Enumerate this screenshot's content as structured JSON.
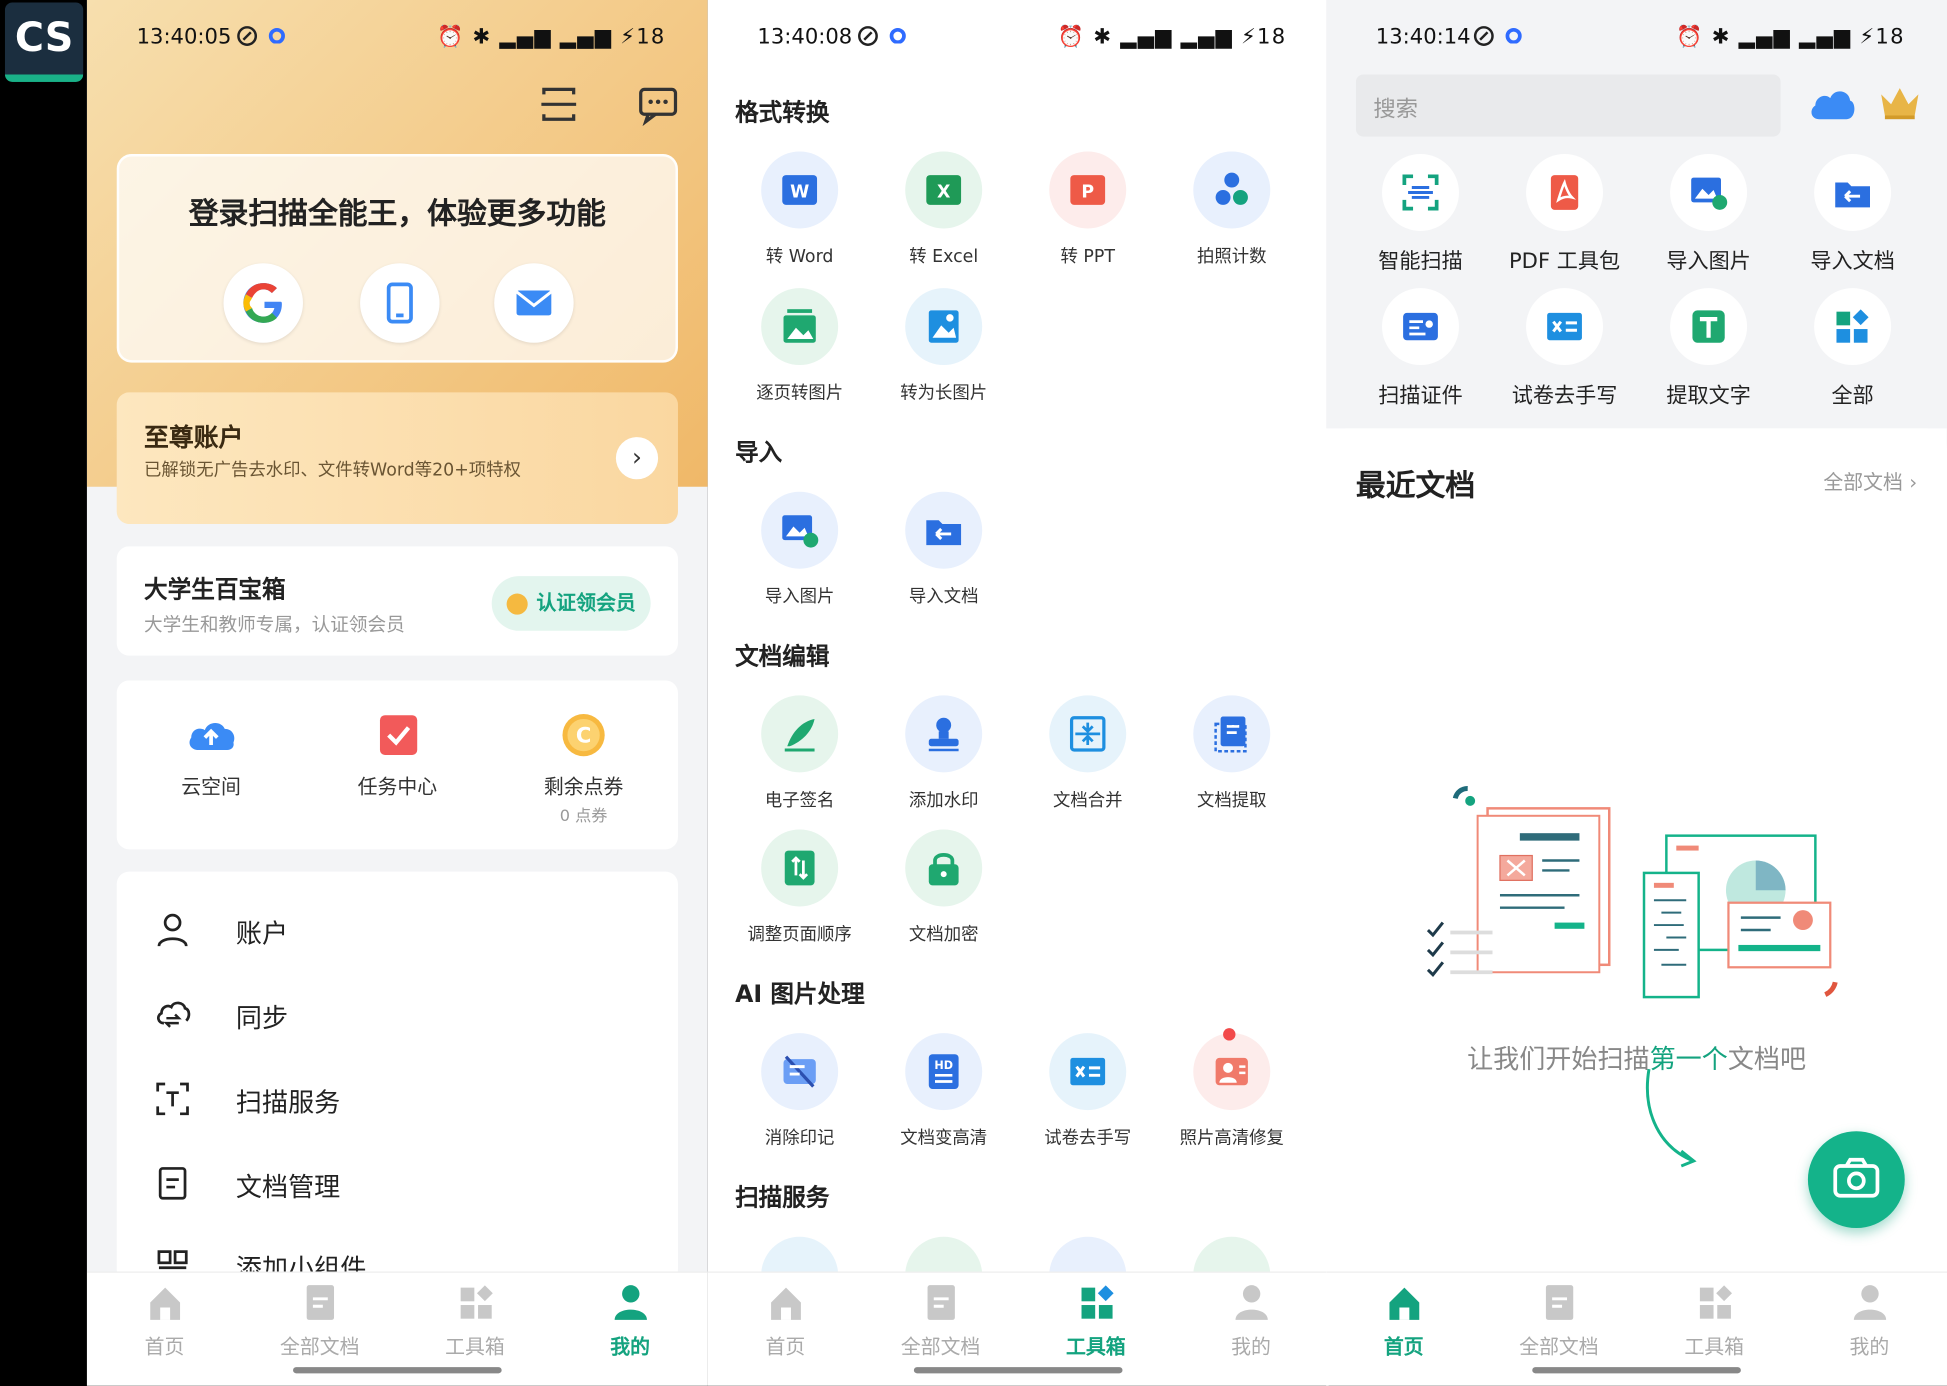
{
  "app_logo": "CS",
  "colors": {
    "brand": "#14a37f",
    "gold": "#f0b868",
    "red": "#f24a4a"
  },
  "status_bars": [
    {
      "time": "13:40:05",
      "right": "18"
    },
    {
      "time": "13:40:08",
      "right": "18"
    },
    {
      "time": "13:40:14",
      "right": "18"
    }
  ],
  "profile": {
    "login_title": "登录扫描全能王，体验更多功能",
    "login_methods": [
      "google-icon",
      "phone-icon",
      "email-icon"
    ],
    "vip": {
      "title": "至尊账户",
      "subtitle": "已解锁无广告去水印、文件转Word等20+项特权"
    },
    "student": {
      "title": "大学生百宝箱",
      "subtitle": "大学生和教师专属，认证领会员",
      "button": "认证领会员"
    },
    "quick": [
      {
        "label": "云空间",
        "sub": ""
      },
      {
        "label": "任务中心",
        "sub": ""
      },
      {
        "label": "剩余点券",
        "sub": "0 点券"
      }
    ],
    "menu": [
      "账户",
      "同步",
      "扫描服务",
      "文档管理",
      "添加小组件"
    ]
  },
  "tools": {
    "sections": [
      {
        "title": "格式转换",
        "items": [
          "转 Word",
          "转 Excel",
          "转 PPT",
          "拍照计数",
          "逐页转图片",
          "转为长图片"
        ]
      },
      {
        "title": "导入",
        "items": [
          "导入图片",
          "导入文档"
        ]
      },
      {
        "title": "文档编辑",
        "items": [
          "电子签名",
          "添加水印",
          "文档合并",
          "文档提取",
          "调整页面顺序",
          "文档加密"
        ]
      },
      {
        "title": "AI 图片处理",
        "items": [
          "消除印记",
          "文档变高清",
          "试卷去手写",
          "照片高清修复"
        ]
      },
      {
        "title": "扫描服务",
        "items": []
      }
    ]
  },
  "home": {
    "search_placeholder": "搜索",
    "quick_tools": [
      "智能扫描",
      "PDF 工具包",
      "导入图片",
      "导入文档",
      "扫描证件",
      "试卷去手写",
      "提取文字",
      "全部"
    ],
    "recent_title": "最近文档",
    "all_docs": "全部文档",
    "empty_prefix": "让我们开始扫描",
    "empty_highlight": "第一个",
    "empty_suffix": "文档吧"
  },
  "nav": [
    "首页",
    "全部文档",
    "工具箱",
    "我的"
  ],
  "active_tab": [
    "我的",
    "工具箱",
    "首页"
  ]
}
